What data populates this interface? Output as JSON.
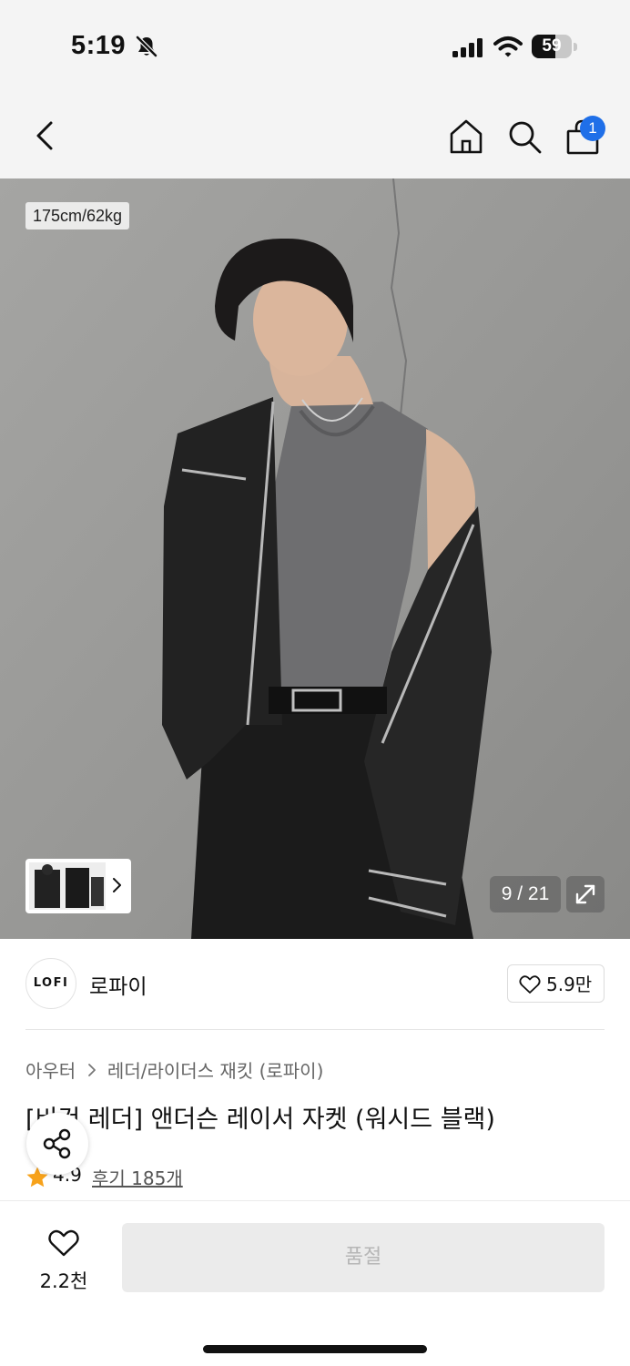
{
  "status_bar": {
    "time": "5:19",
    "battery_level": 59,
    "battery_label": "59",
    "icons": [
      "bell-slash-icon",
      "signal-icon",
      "wifi-icon",
      "battery-icon"
    ]
  },
  "nav": {
    "icons": [
      "back-icon",
      "home-icon",
      "search-icon",
      "cart-icon"
    ],
    "cart_count": "1"
  },
  "gallery": {
    "model_size": "175cm/62kg",
    "counter": "9 / 21",
    "icons": [
      "chevron-right-icon",
      "expand-icon"
    ]
  },
  "brand": {
    "logo_text": "LOFI",
    "name": "로파이",
    "like_count": "5.9만",
    "like_icon": "heart-outline-icon"
  },
  "product": {
    "breadcrumb": [
      "아우터",
      "레더/라이더스 재킷 (로파이)"
    ],
    "title": "[비건 레더] 앤더슨 레이서 자켓 (워시드 블랙)",
    "rating": "4.9",
    "review_label": "후기 185개",
    "rating_icon": "star-icon",
    "rating_color": "#f7a21b"
  },
  "share": {
    "icon": "share-icon"
  },
  "bottom_bar": {
    "wish_count": "2.2천",
    "wish_icon": "heart-outline-icon",
    "action_label": "품절"
  },
  "colors": {
    "badge": "#1f6fe8",
    "header_bg": "#f4f4f4",
    "soldout_bg": "#ebebeb",
    "soldout_text": "#b6b6b6"
  }
}
